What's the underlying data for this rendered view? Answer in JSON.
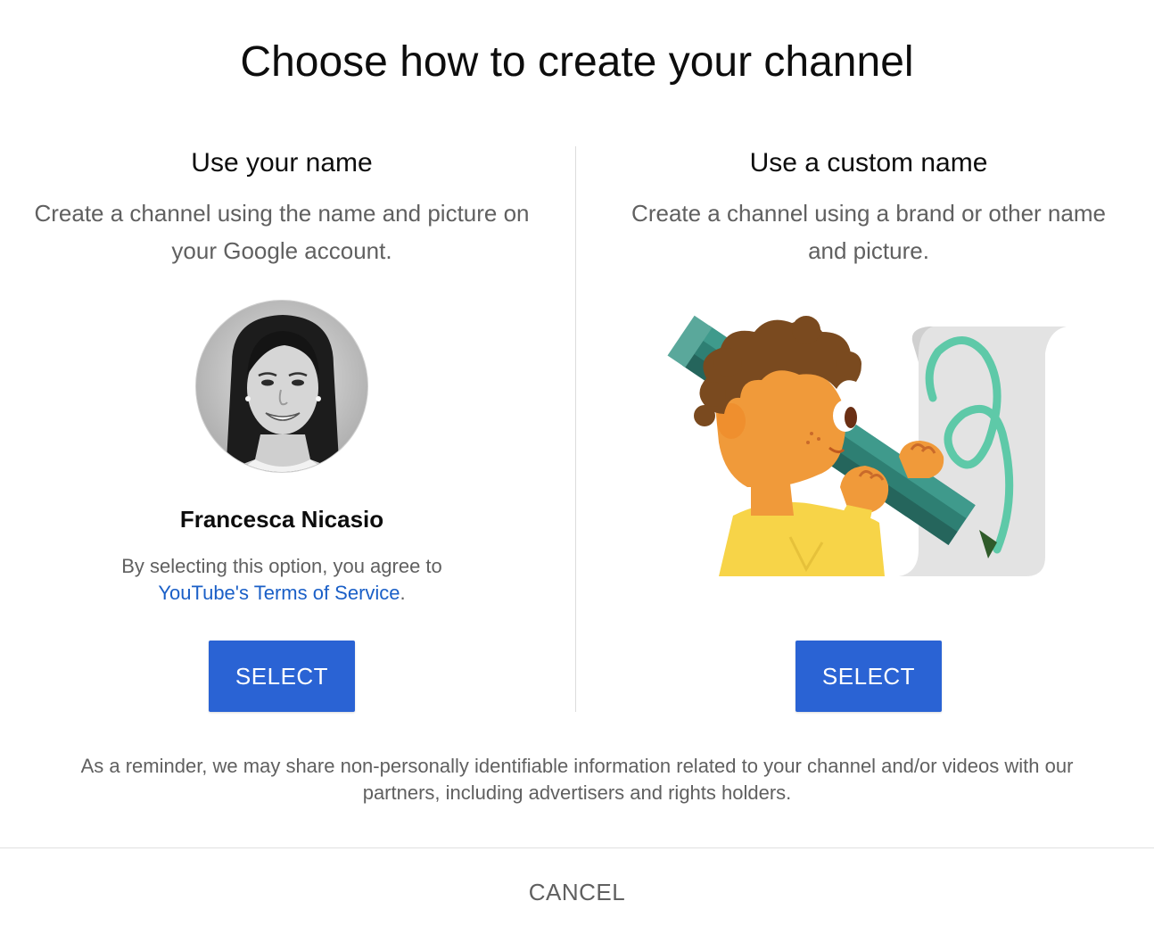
{
  "dialog": {
    "title": "Choose how to create your channel",
    "reminder": "As a reminder, we may share non-personally identifiable information related to your channel and/or videos with our partners, including advertisers and rights holders.",
    "cancel_label": "CANCEL"
  },
  "option_name": {
    "title": "Use your name",
    "description": "Create a channel using the name and picture on your Google account.",
    "account_name": "Francesca Nicasio",
    "terms_prefix": "By selecting this option, you agree to",
    "terms_link": "YouTube's Terms of Service",
    "terms_suffix": ".",
    "select_label": "SELECT"
  },
  "option_custom": {
    "title": "Use a custom name",
    "description": "Create a channel using a brand or other name and picture.",
    "select_label": "SELECT"
  },
  "colors": {
    "button_blue": "#2a63d4",
    "link_blue": "#1a5fc7",
    "secondary_text": "#606060"
  }
}
